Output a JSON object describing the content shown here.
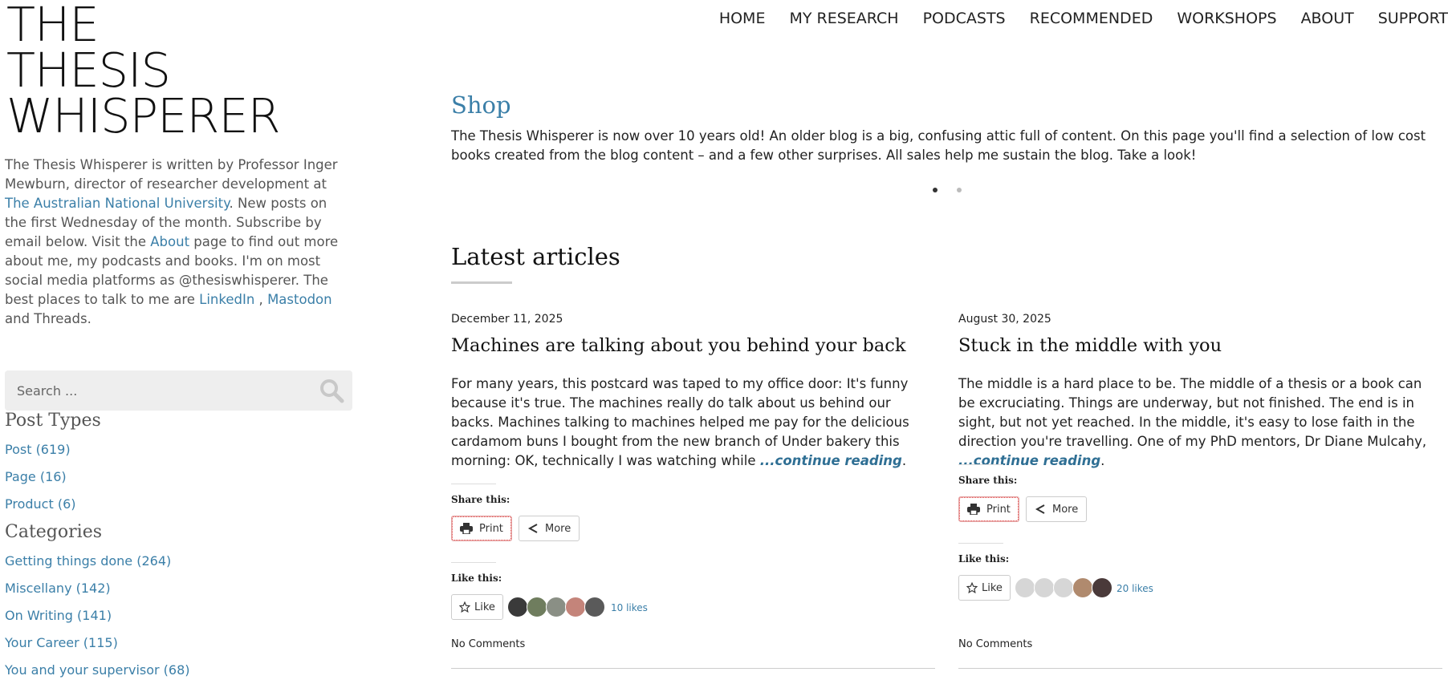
{
  "site": {
    "title_lines": [
      "THE",
      "THESIS",
      "WHISPERER"
    ]
  },
  "sidebar": {
    "intro_parts": {
      "p1": "The Thesis Whisperer is written by Professor Inger Mewburn, director of researcher development at ",
      "anu_link": "The Australian National University",
      "p2": ". New posts on the first Wednesday of the month. Subscribe by email below. Visit the ",
      "about_link": "About",
      "p3": " page to find out more about me, my podcasts and books. I'm on most social media platforms as @thesiswhisperer. The best places to talk to me are ",
      "linkedin_link": "LinkedIn",
      "p4": " , ",
      "mastodon_link": "Mastodon",
      "p5": " and Threads."
    },
    "search": {
      "placeholder": "Search ..."
    },
    "post_types": {
      "title": "Post Types",
      "items": [
        "Post (619)",
        "Page (16)",
        "Product (6)"
      ]
    },
    "categories": {
      "title": "Categories",
      "items": [
        "Getting things done (264)",
        "Miscellany (142)",
        "On Writing (141)",
        "Your Career (115)",
        "You and your supervisor (68)"
      ]
    }
  },
  "nav": {
    "items": [
      "HOME",
      "MY RESEARCH",
      "PODCASTS",
      "RECOMMENDED",
      "WORKSHOPS",
      "ABOUT",
      "SUPPORT"
    ]
  },
  "shop": {
    "title": "Shop",
    "text": "The Thesis Whisperer is now over 10 years old! An older blog is a big, confusing attic full of content. On this page you'll find a selection of low cost books created from the blog content – and a few other surprises. All sales help me sustain the blog. Take a look!"
  },
  "latest": {
    "title": "Latest articles"
  },
  "articles": [
    {
      "date": "December 11, 2025",
      "title": "Machines are talking about you behind your back",
      "excerpt": "For many years, this postcard was taped to my office door: It's funny because it's true. The machines really do talk about us behind our backs. Machines talking to machines helped me pay for the delicious cardamom buns I bought from the new branch of Under bakery this morning: OK, technically I was watching while ",
      "continue": "...continue reading",
      "share_label": "Share this:",
      "print_label": "Print",
      "more_label": "More",
      "like_heading": "Like this:",
      "like_label": "Like",
      "likes": "10 likes",
      "comments": "No Comments"
    },
    {
      "date": "August 30, 2025",
      "title": "Stuck in the middle with you",
      "excerpt": "The middle is a hard place to be. The middle of a thesis or a book can be excruciating. Things are underway, but not finished. The end is in sight, but not yet reached. In the middle, it's easy to lose faith in the direction you're travelling. One of my PhD mentors, Dr Diane Mulcahy, ",
      "continue": "...continue reading",
      "share_label": "Share this:",
      "print_label": "Print",
      "more_label": "More",
      "like_heading": "Like this:",
      "like_label": "Like",
      "likes": "20 likes",
      "comments": "No Comments"
    }
  ],
  "colors": {
    "link": "#3b7fa8",
    "text": "#222222",
    "muted": "#555555"
  }
}
